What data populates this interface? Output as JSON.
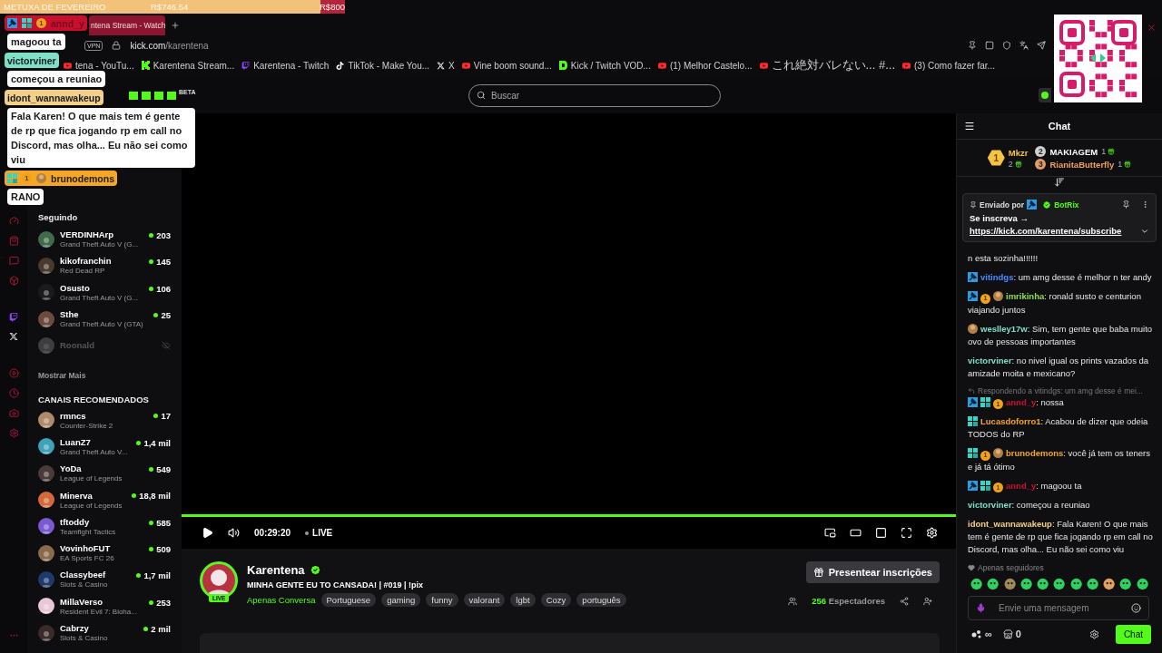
{
  "goal_bar": {
    "title": "METUXA DE FEVEREIRO",
    "current": "R$746.54",
    "target": "R$800",
    "level": 0.93
  },
  "overlay_chat": [
    {
      "user": "annd_y",
      "color": "#c8102e",
      "badges": [
        {
          "kind": "mod"
        },
        {
          "kind": "og"
        },
        {
          "kind": "sub",
          "label": "1"
        }
      ],
      "message": "magoou ta"
    },
    {
      "user": "victorviner",
      "color": "#7fe0c8",
      "message": "começou a reuniao"
    },
    {
      "user": "idont_wannawakeup",
      "color": "#f3d08a",
      "message": "Fala Karen! O que mais tem é gente de rp que fica jogando rp em call no Discord, mas olha... Eu não sei como viu"
    },
    {
      "user": "brunodemons",
      "color": "#f5a623",
      "badges": [
        {
          "kind": "og"
        },
        {
          "kind": "sub",
          "label": "1"
        },
        {
          "kind": "emote"
        }
      ],
      "message": "RANO"
    }
  ],
  "browser": {
    "tab": {
      "title": "ntena Stream - Watch",
      "selected": true
    },
    "address": {
      "vpn": "VPN",
      "host": "kick.com",
      "path": "/karentena"
    },
    "bookmarks": [
      {
        "kind": "youtube",
        "label": "tena - YouTu..."
      },
      {
        "kind": "kick",
        "label": "Karentena Stream..."
      },
      {
        "kind": "twitch",
        "label": "Karentena - Twitch"
      },
      {
        "kind": "tiktok",
        "label": "TikTok - Make You..."
      },
      {
        "kind": "x",
        "label": "X"
      },
      {
        "kind": "youtube",
        "label": "Vine boom sound..."
      },
      {
        "kind": "vod",
        "label": "Kick / Twitch VOD..."
      },
      {
        "kind": "youtube",
        "label": "(1) Melhor Castelo..."
      },
      {
        "kind": "youtube",
        "label": "これ絶対バレない... #...",
        "cjk": true
      },
      {
        "kind": "youtube",
        "label": "(3) Como fazer far..."
      }
    ]
  },
  "site": {
    "beta": "BETA",
    "search": {
      "placeholder": "Buscar"
    }
  },
  "sidebar": {
    "following_title": "Seguindo",
    "following": [
      {
        "name": "VERDINHArp",
        "category": "Grand Theft Auto V (G...",
        "viewers": "203",
        "live": true
      },
      {
        "name": "kikofranchin",
        "category": "Red Dead RP",
        "viewers": "145",
        "live": true
      },
      {
        "name": "Osusto",
        "category": "Grand Theft Auto V (G...",
        "viewers": "106",
        "live": true
      },
      {
        "name": "Sthe",
        "category": "Grand Theft Auto V (GTA)",
        "viewers": "25",
        "live": true
      },
      {
        "name": "Roonald",
        "live": false
      }
    ],
    "show_more": "Mostrar Mais",
    "recommended_title": "CANAIS RECOMENDADOS",
    "recommended": [
      {
        "name": "rmncs",
        "category": "Counter-Strike 2",
        "viewers": "17",
        "live": true
      },
      {
        "name": "LuanZ7",
        "category": "Grand Theft Auto V...",
        "viewers": "1,4 mil",
        "live": true
      },
      {
        "name": "YoDa",
        "category": "League of Legends",
        "viewers": "549",
        "live": true
      },
      {
        "name": "Minerva",
        "category": "League of Legends",
        "viewers": "18,8 mil",
        "live": true
      },
      {
        "name": "tftoddy",
        "category": "Teamfight Tactics",
        "viewers": "585",
        "live": true
      },
      {
        "name": "VovinhoFUT",
        "category": "EA Sports FC 26",
        "viewers": "509",
        "live": true
      },
      {
        "name": "Classybeef",
        "category": "Slots & Casino",
        "viewers": "1,7 mil",
        "live": true
      },
      {
        "name": "MillaVerso",
        "category": "Resident Evil 7: Bioha...",
        "viewers": "253",
        "live": true
      },
      {
        "name": "Cabrzy",
        "category": "Slots & Casino",
        "viewers": "2 mil",
        "live": true
      }
    ]
  },
  "player": {
    "time": "00:29:20",
    "live_label": "LIVE",
    "live": true
  },
  "stream": {
    "channel": "Karentena",
    "verified": true,
    "live_badge": "LIVE",
    "title": "MINHA GENTE EU TO CANSADA! | #019 | !pix",
    "category": "Apenas Conversa",
    "tags": [
      "Portuguese",
      "gaming",
      "funny",
      "valorant",
      "lgbt",
      "Cozy",
      "português"
    ],
    "gift_button": "Presentear inscrições",
    "viewers": "256",
    "viewers_label": "Espectadores"
  },
  "chat": {
    "title": "Chat",
    "leaderboard": [
      {
        "rank": "1",
        "name": "Mkzr",
        "count": "2"
      },
      {
        "rank": "2",
        "name": "MAKIAGEM",
        "count": "1"
      },
      {
        "rank": "3",
        "name": "RianitaButterfly",
        "count": "1"
      }
    ],
    "pinned": {
      "label": "Enviado por",
      "user": "BotRix",
      "text": "Se inscreva →",
      "link": "https://kick.com/karentena/subscribe"
    },
    "messages": [
      {
        "text": "n esta sozinha!!!!!!"
      },
      {
        "badges": [
          {
            "kind": "mod"
          }
        ],
        "user": "vitindgs",
        "color": "#4a8cff",
        "text": ": um amg desse é melhor n ter andy"
      },
      {
        "badges": [
          {
            "kind": "mod"
          },
          {
            "kind": "sub",
            "label": "1"
          },
          {
            "kind": "emote"
          }
        ],
        "user": "imrikinha",
        "color": "#8ee04a",
        "text": ": ronald susto e centurion viajando juntos"
      },
      {
        "badges": [
          {
            "kind": "emote"
          }
        ],
        "user": "weslley17w",
        "color": "#7fe0c8",
        "text": ": Sim, tem gente que baba muito ovo de pessoas importantes"
      },
      {
        "user": "victorviner",
        "color": "#7fe0c8",
        "text": ": no nivel igual os prints vazados da amizade moita e mexicano?"
      },
      {
        "reply": "Respondendo a vitindgs: um amg desse é mei...",
        "badges": [
          {
            "kind": "mod"
          },
          {
            "kind": "og"
          },
          {
            "kind": "sub",
            "label": "1"
          }
        ],
        "user": "annd_y",
        "color": "#c8102e",
        "text": ": nossa"
      },
      {
        "badges": [
          {
            "kind": "og"
          }
        ],
        "user": "Lucasdoforro1",
        "color": "#f5a623",
        "text": ": Acabou de dizer que odeia TODOS do RP"
      },
      {
        "badges": [
          {
            "kind": "og"
          },
          {
            "kind": "sub",
            "label": "1"
          },
          {
            "kind": "emote"
          }
        ],
        "user": "brunodemons",
        "color": "#f5a623",
        "text": ": você já tem os teners e já tá ótimo"
      },
      {
        "badges": [
          {
            "kind": "mod"
          },
          {
            "kind": "og"
          },
          {
            "kind": "sub",
            "label": "1"
          }
        ],
        "user": "annd_y",
        "color": "#c8102e",
        "text": ": magoou ta"
      },
      {
        "user": "victorviner",
        "color": "#7fe0c8",
        "text": ": começou a reuniao"
      },
      {
        "user": "idont_wannawakeup",
        "color": "#f3d08a",
        "text": ": Fala Karen! O que mais tem é gente de rp que fica jogando rp em call no Discord, mas olha... Eu não sei como viu"
      }
    ],
    "followers_only": "Apenas seguidores",
    "input": {
      "placeholder": "Envie uma mensagem"
    },
    "points": "∞",
    "shop_count": "0",
    "send_button": "Chat"
  }
}
